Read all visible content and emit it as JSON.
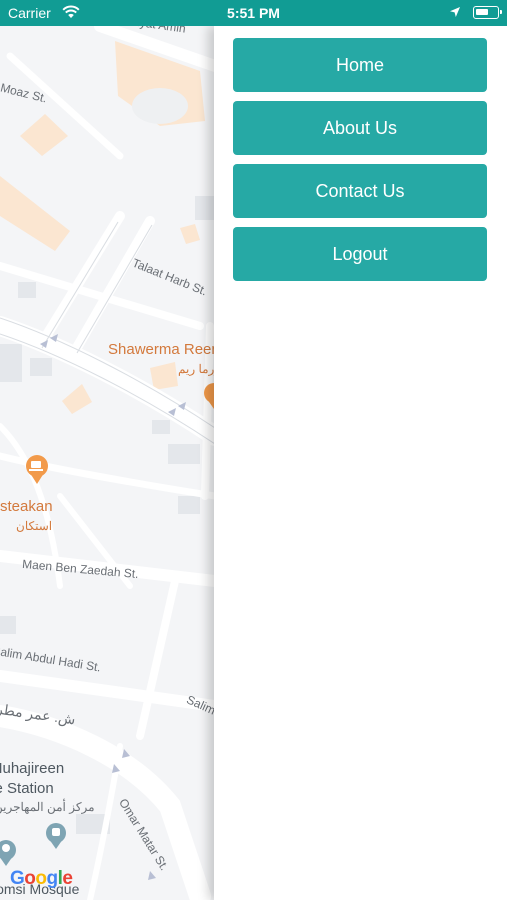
{
  "status_bar": {
    "carrier": "Carrier",
    "time": "5:51 PM",
    "icons": [
      "wifi-icon",
      "location-arrow-icon",
      "battery-icon"
    ]
  },
  "colors": {
    "status_bar": "#119c94",
    "menu_button": "#26a9a5",
    "poi": "#d3793c"
  },
  "map": {
    "street_labels": {
      "azbakiyat": "Azbakiyat Amin",
      "moaz": "Moaz St.",
      "talaat": "Talaat Harb St.",
      "maen": "Maen Ben Zaedah St.",
      "salim1": "Salim Abdul Hadi St.",
      "salim2": "Salim",
      "omar": "Omar Matar St.",
      "omar_ar": "ش. عمر مطر"
    },
    "pois": {
      "shawerma": "Shawerma Reem",
      "shawerma_ar": "شاورما ريم",
      "esteakan": "Esteakan",
      "esteakan_ar": "استكان",
      "muhajireen": "Muhajireen",
      "station": "Police Station",
      "muhajireen_ar": "مركز أمن المهاجرين",
      "mosque": "Homsi Mosque"
    },
    "logo": [
      "G",
      "o",
      "o",
      "g",
      "l",
      "e"
    ]
  },
  "menu": {
    "items": [
      {
        "label": "Home"
      },
      {
        "label": "About Us"
      },
      {
        "label": "Contact Us"
      },
      {
        "label": "Logout"
      }
    ]
  }
}
